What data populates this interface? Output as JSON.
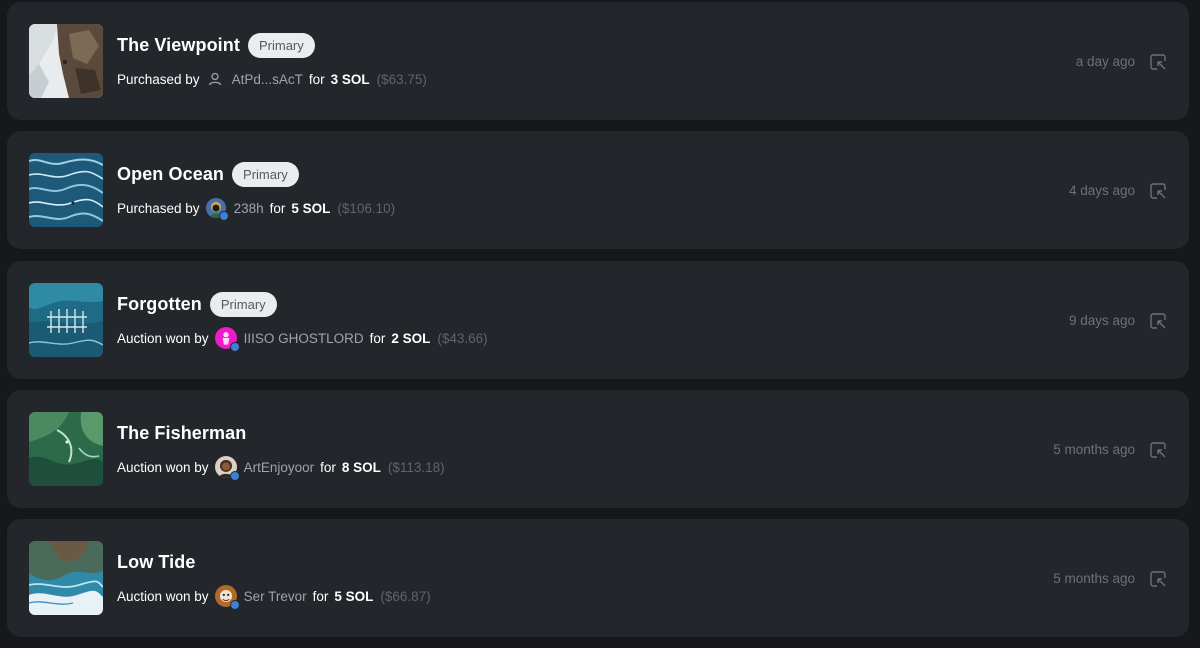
{
  "sales": [
    {
      "title": "The Viewpoint",
      "badge": "Primary",
      "action": "Purchased by",
      "user": "AtPd...sAcT",
      "user_avatar": "generic-user-icon",
      "for_label": "for",
      "amount": "3 SOL",
      "usd": "($63.75)",
      "time": "a day ago"
    },
    {
      "title": "Open Ocean",
      "badge": "Primary",
      "action": "Purchased by",
      "user": "238h",
      "user_avatar": "avatar-image",
      "for_label": "for",
      "amount": "5 SOL",
      "usd": "($106.10)",
      "time": "4 days ago"
    },
    {
      "title": "Forgotten",
      "badge": "Primary",
      "action": "Auction won by",
      "user": "IIISO GHOSTLORD",
      "user_avatar": "avatar-image",
      "for_label": "for",
      "amount": "2 SOL",
      "usd": "($43.66)",
      "time": "9 days ago"
    },
    {
      "title": "The Fisherman",
      "badge": "",
      "action": "Auction won by",
      "user": "ArtEnjoyoor",
      "user_avatar": "avatar-image",
      "for_label": "for",
      "amount": "8 SOL",
      "usd": "($113.18)",
      "time": "5 months ago"
    },
    {
      "title": "Low Tide",
      "badge": "",
      "action": "Auction won by",
      "user": "Ser Trevor",
      "user_avatar": "avatar-image",
      "for_label": "for",
      "amount": "5 SOL",
      "usd": "($66.87)",
      "time": "5 months ago"
    }
  ],
  "icons": {
    "open_link": "open-external-icon",
    "verified": "verified-badge-icon"
  },
  "colors": {
    "background": "#16181c",
    "card": "#23262b",
    "badge_bg": "#ebecee",
    "verified": "#3b82d6",
    "muted_text": "#6c717a"
  }
}
